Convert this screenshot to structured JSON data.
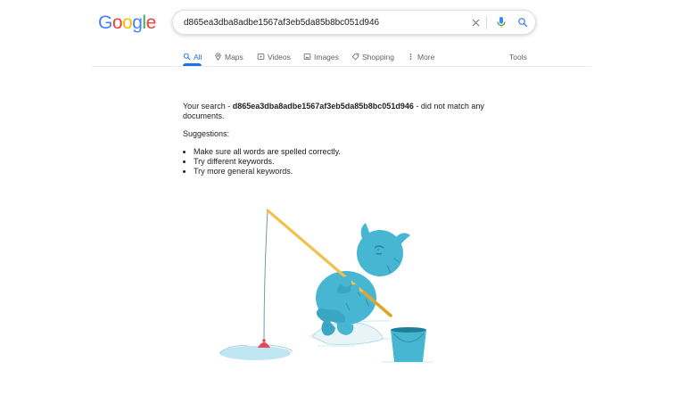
{
  "logo": {
    "letters": [
      "G",
      "o",
      "o",
      "g",
      "l",
      "e"
    ],
    "colors": [
      "#4285f4",
      "#ea4335",
      "#fbbc05",
      "#4285f4",
      "#34a853",
      "#ea4335"
    ]
  },
  "search": {
    "query": "d865ea3dba8adbe1567af3eb5da85b8bc051d946",
    "clear_icon": "close-icon",
    "mic_icon": "microphone-icon",
    "search_icon": "search-icon"
  },
  "tabs": [
    {
      "label": "All",
      "icon": "search-icon",
      "active": true
    },
    {
      "label": "Maps",
      "icon": "map-pin-icon",
      "active": false
    },
    {
      "label": "Videos",
      "icon": "play-icon",
      "active": false
    },
    {
      "label": "Images",
      "icon": "image-icon",
      "active": false
    },
    {
      "label": "Shopping",
      "icon": "tag-icon",
      "active": false
    },
    {
      "label": "More",
      "icon": "more-vert-icon",
      "active": false
    }
  ],
  "tools_label": "Tools",
  "result": {
    "prefix": "Your search - ",
    "query": "d865ea3dba8adbe1567af3eb5da85b8bc051d946",
    "suffix": " - did not match any documents.",
    "suggestions_title": "Suggestions:",
    "suggestions": [
      "Make sure all words are spelled correctly.",
      "Try different keywords.",
      "Try more general keywords."
    ]
  },
  "colors": {
    "accent": "#1a73e8",
    "text": "#202124",
    "muted": "#5f6368",
    "creature": "#47b6d2",
    "rod": "#f0c24a",
    "bobber": "#e34a5a"
  }
}
